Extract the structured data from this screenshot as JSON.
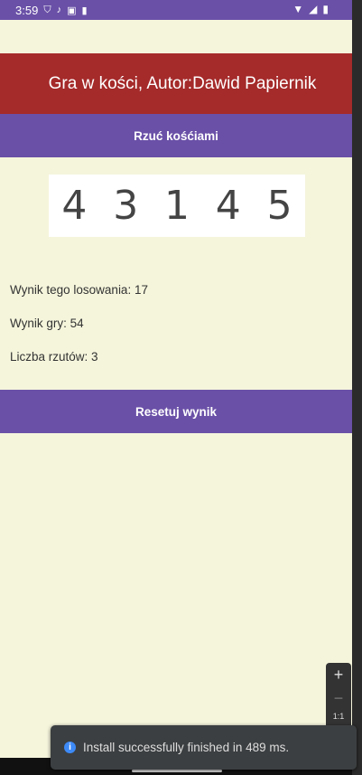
{
  "status_bar": {
    "time": "3:59",
    "icons": [
      "shield-icon",
      "mic-icon",
      "a-icon",
      "sd-card-icon"
    ],
    "right_icons": [
      "wifi-icon",
      "signal-icon",
      "battery-icon"
    ]
  },
  "app": {
    "title": "Gra w kości, Autor:Dawid Papiernik",
    "roll_button": "Rzuć kośćiami",
    "dice": [
      "4",
      "3",
      "1",
      "4",
      "5"
    ],
    "round_result": "Wynik tego losowania: 17",
    "game_score": "Wynik gry: 54",
    "roll_count": "Liczba rzutów: 3",
    "reset_button": "Resetuj wynik"
  },
  "emulator": {
    "zoom_in": "+",
    "zoom_out": "−",
    "zoom_reset": "1:1"
  },
  "toast": {
    "message": "Install successfully finished in 489 ms."
  },
  "colors": {
    "background": "#f5f5dc",
    "title_bar": "#a52a2a",
    "buttons": "#6a50a7"
  }
}
